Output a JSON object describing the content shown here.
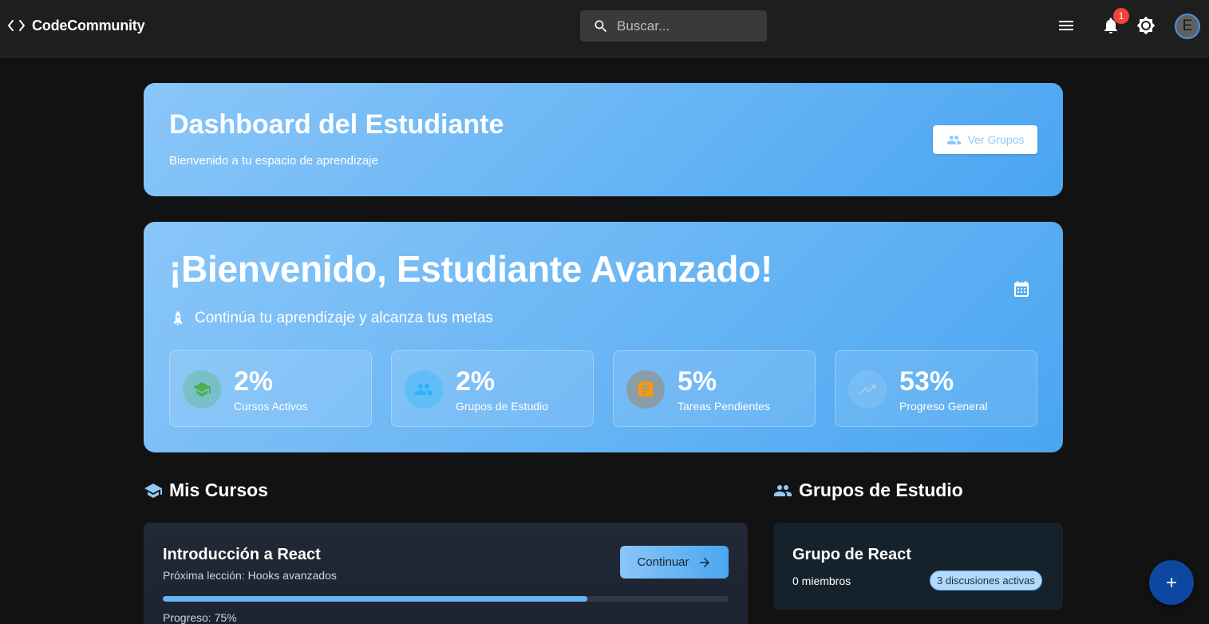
{
  "app": {
    "brand": "CodeCommunity",
    "search_placeholder": "Buscar...",
    "notification_count": "1",
    "avatar_initial": "E"
  },
  "header": {
    "title": "Dashboard del Estudiante",
    "subtitle": "Bienvenido a tu espacio de aprendizaje",
    "button_label": "Ver Grupos"
  },
  "welcome": {
    "title": "¡Bienvenido, Estudiante Avanzado!",
    "subtitle": "Continúa tu aprendizaje y alcanza tus metas",
    "stats": [
      {
        "value": "2%",
        "label": "Cursos Activos",
        "icon": "school-icon",
        "color": "#4caf50"
      },
      {
        "value": "2%",
        "label": "Grupos de Estudio",
        "icon": "group-icon",
        "color": "#29b6f6"
      },
      {
        "value": "5%",
        "label": "Tareas Pendientes",
        "icon": "assignment-icon",
        "color": "#ff9800"
      },
      {
        "value": "53%",
        "label": "Progreso General",
        "icon": "trending-up-icon",
        "color": "#9e9e9e"
      }
    ]
  },
  "courses": {
    "title": "Mis Cursos",
    "items": [
      {
        "name": "Introducción a React",
        "next_lesson": "Próxima lección: Hooks avanzados",
        "button_label": "Continuar",
        "progress_label": "Progreso: 75%",
        "progress": 0.75
      }
    ]
  },
  "groups": {
    "title": "Grupos de Estudio",
    "items": [
      {
        "name": "Grupo de React",
        "members": "0 miembros",
        "chip": "3 discusiones activas"
      }
    ]
  },
  "colors": {
    "accent": "#4aa6f1",
    "background": "#121212",
    "topbar": "#1e1e1e",
    "fab": "#0d47a1"
  }
}
